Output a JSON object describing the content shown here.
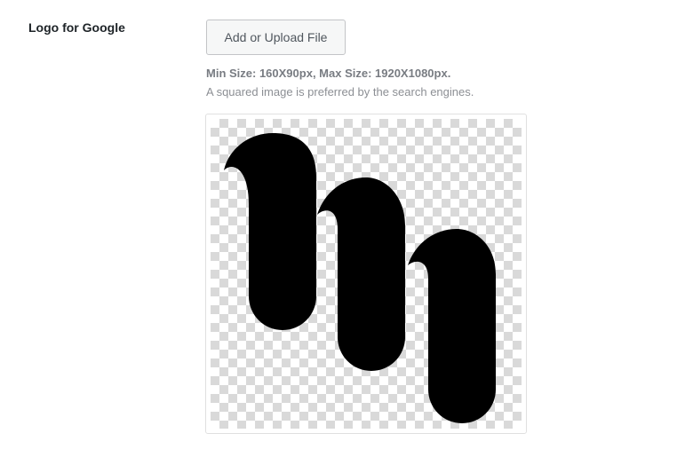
{
  "field": {
    "label": "Logo for Google",
    "upload_button_label": "Add or Upload File",
    "size_hint": "Min Size: 160X90px, Max Size: 1920X1080px.",
    "preference_hint": "A squared image is preferred by the search engines."
  },
  "preview": {
    "icon": "wave-logo-icon",
    "logo_color": "#000000"
  }
}
